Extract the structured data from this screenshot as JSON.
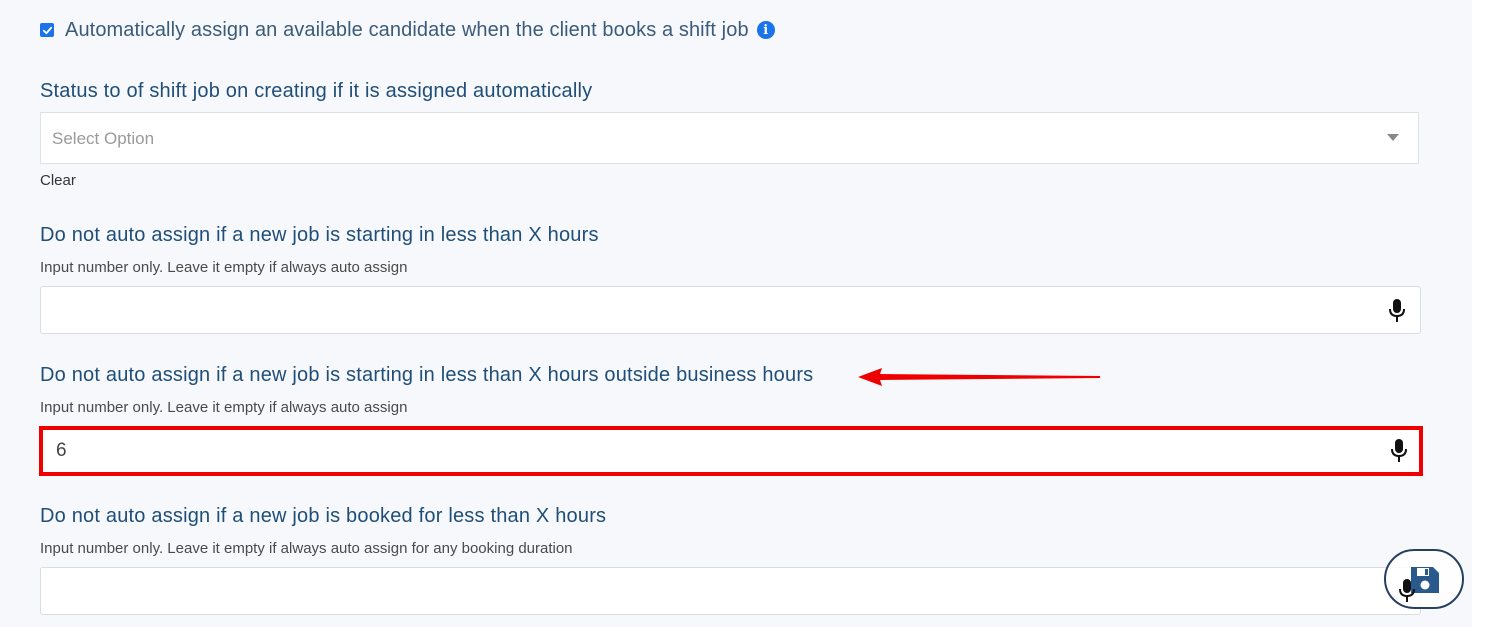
{
  "auto_assign": {
    "checked": true,
    "label": "Automatically assign an available candidate when the client books a shift job",
    "info_icon": "info-icon"
  },
  "status_section": {
    "heading": "Status to of shift job on creating if it is assigned automatically",
    "select_placeholder": "Select Option",
    "clear_label": "Clear"
  },
  "hours_section": {
    "heading": "Do not auto assign if a new job is starting in less than X hours",
    "hint": "Input number only. Leave it empty if always auto assign",
    "value": ""
  },
  "outside_hours_section": {
    "heading": "Do not auto assign if a new job is starting in less than X hours outside business hours",
    "hint": "Input number only. Leave it empty if always auto assign",
    "value": "6"
  },
  "booked_section": {
    "heading": "Do not auto assign if a new job is booked for less than X hours",
    "hint": "Input number only. Leave it empty if always auto assign for any booking duration",
    "value": ""
  },
  "icons": {
    "mic": "microphone-icon",
    "save": "floppy-disk-icon",
    "caret": "caret-down-icon"
  },
  "colors": {
    "accent": "#1a73e8",
    "heading": "#1f4e79",
    "highlight": "#ee0000"
  }
}
